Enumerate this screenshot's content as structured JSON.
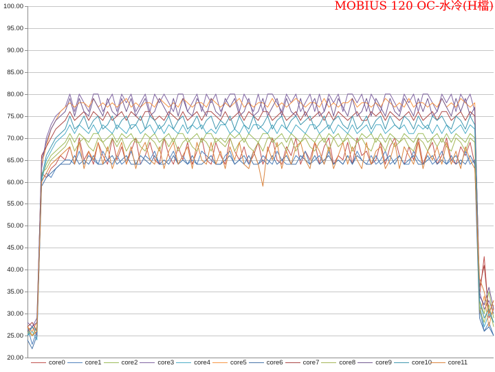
{
  "chart_data": {
    "type": "line",
    "title": "MOBIUS 120 OC-水冷(H檔)",
    "title_color": "#FF0000",
    "xlabel": "",
    "ylabel": "",
    "ylim": [
      20,
      100
    ],
    "y_ticks": [
      "20.00",
      "25.00",
      "30.00",
      "35.00",
      "40.00",
      "45.00",
      "50.00",
      "55.00",
      "60.00",
      "65.00",
      "70.00",
      "75.00",
      "80.00",
      "85.00",
      "90.00",
      "95.00",
      "100.00"
    ],
    "grid": true,
    "legend": "bottom",
    "series": [
      {
        "name": "core0",
        "color": "#C0504D",
        "values": [
          26,
          27,
          25,
          62,
          61,
          63,
          64,
          66,
          65,
          68,
          64,
          70,
          65,
          67,
          64,
          69,
          66,
          64,
          70,
          65,
          68,
          64,
          67,
          70,
          64,
          66,
          69,
          65,
          64,
          70,
          66,
          64,
          68,
          65,
          69,
          64,
          67,
          70,
          65,
          64,
          69,
          66,
          64,
          70,
          67,
          65,
          68,
          64,
          66,
          69,
          64,
          67,
          70,
          65,
          64,
          68,
          66,
          70,
          64,
          67,
          65,
          69,
          64,
          68,
          70,
          64,
          66,
          65,
          69,
          64,
          70,
          66,
          67,
          64,
          65,
          69,
          64,
          68,
          70,
          66,
          64,
          68,
          65,
          70,
          64,
          67,
          69,
          64,
          66,
          70,
          65,
          64,
          68,
          66,
          69,
          64,
          34,
          43,
          29,
          31
        ]
      },
      {
        "name": "core1",
        "color": "#4F81BD",
        "values": [
          27,
          23,
          26,
          60,
          62,
          61,
          63,
          64,
          65,
          65,
          64,
          67,
          64,
          66,
          65,
          64,
          67,
          65,
          64,
          66,
          64,
          65,
          67,
          64,
          64,
          66,
          65,
          67,
          64,
          64,
          65,
          67,
          64,
          66,
          64,
          65,
          64,
          67,
          66,
          65,
          64,
          64,
          66,
          67,
          64,
          65,
          66,
          64,
          67,
          64,
          66,
          65,
          64,
          67,
          65,
          64,
          64,
          66,
          65,
          67,
          64,
          65,
          66,
          64,
          67,
          64,
          65,
          64,
          66,
          64,
          67,
          65,
          64,
          66,
          64,
          65,
          67,
          64,
          65,
          66,
          64,
          64,
          67,
          65,
          64,
          66,
          64,
          65,
          67,
          64,
          65,
          66,
          64,
          67,
          64,
          65,
          31,
          26,
          28,
          25
        ]
      },
      {
        "name": "core2",
        "color": "#9BBB59",
        "values": [
          26,
          25,
          27,
          61,
          64,
          66,
          67,
          68,
          69,
          71,
          69,
          71,
          70,
          69,
          71,
          71,
          69,
          70,
          71,
          69,
          71,
          70,
          71,
          69,
          69,
          71,
          70,
          71,
          69,
          70,
          71,
          69,
          71,
          71,
          69,
          70,
          71,
          69,
          71,
          71,
          69,
          70,
          69,
          71,
          70,
          71,
          69,
          71,
          70,
          69,
          71,
          71,
          69,
          70,
          71,
          69,
          71,
          70,
          69,
          71,
          70,
          69,
          71,
          69,
          71,
          70,
          71,
          69,
          71,
          70,
          69,
          71,
          70,
          71,
          69,
          71,
          69,
          71,
          70,
          69,
          71,
          70,
          69,
          71,
          71,
          69,
          70,
          71,
          69,
          71,
          69,
          71,
          70,
          69,
          71,
          70,
          33,
          30,
          35,
          29
        ]
      },
      {
        "name": "core3",
        "color": "#8064A2",
        "values": [
          28,
          27,
          29,
          63,
          70,
          73,
          75,
          76,
          77,
          80,
          76,
          80,
          78,
          76,
          80,
          80,
          76,
          78,
          80,
          76,
          80,
          78,
          80,
          76,
          78,
          80,
          76,
          80,
          78,
          80,
          78,
          76,
          80,
          80,
          76,
          78,
          80,
          76,
          80,
          78,
          80,
          76,
          78,
          80,
          80,
          76,
          80,
          78,
          76,
          80,
          76,
          80,
          80,
          78,
          76,
          80,
          78,
          80,
          76,
          78,
          80,
          76,
          80,
          76,
          80,
          78,
          80,
          76,
          80,
          80,
          78,
          80,
          76,
          80,
          78,
          76,
          80,
          80,
          78,
          76,
          80,
          78,
          80,
          76,
          80,
          80,
          78,
          76,
          80,
          78,
          80,
          76,
          80,
          78,
          80,
          76,
          35,
          31,
          33,
          30
        ]
      },
      {
        "name": "core4",
        "color": "#4BACC6",
        "values": [
          25,
          26,
          24,
          60,
          65,
          67,
          69,
          70,
          71,
          73,
          71,
          73,
          72,
          71,
          73,
          71,
          73,
          72,
          71,
          73,
          72,
          71,
          73,
          73,
          71,
          72,
          73,
          71,
          73,
          71,
          73,
          72,
          71,
          73,
          71,
          73,
          72,
          73,
          71,
          72,
          71,
          73,
          73,
          71,
          72,
          71,
          73,
          71,
          73,
          73,
          72,
          71,
          73,
          71,
          73,
          72,
          71,
          73,
          72,
          71,
          73,
          73,
          71,
          72,
          73,
          71,
          73,
          72,
          71,
          73,
          71,
          72,
          73,
          71,
          73,
          73,
          71,
          72,
          73,
          72,
          73,
          71,
          71,
          73,
          72,
          73,
          71,
          73,
          71,
          73,
          71,
          72,
          73,
          71,
          73,
          72,
          32,
          27,
          30,
          28
        ]
      },
      {
        "name": "core5",
        "color": "#F79646",
        "values": [
          27,
          26,
          28,
          64,
          68,
          72,
          74,
          76,
          77,
          78,
          77,
          78,
          78,
          77,
          79,
          77,
          78,
          77,
          78,
          77,
          78,
          79,
          77,
          78,
          77,
          78,
          78,
          77,
          79,
          78,
          77,
          78,
          77,
          79,
          78,
          77,
          78,
          78,
          77,
          79,
          78,
          77,
          78,
          77,
          78,
          79,
          77,
          78,
          77,
          78,
          78,
          77,
          79,
          77,
          78,
          77,
          78,
          79,
          78,
          77,
          78,
          78,
          77,
          79,
          77,
          78,
          77,
          78,
          78,
          79,
          77,
          78,
          78,
          77,
          78,
          77,
          79,
          78,
          77,
          78,
          77,
          79,
          77,
          78,
          78,
          77,
          78,
          77,
          79,
          77,
          78,
          77,
          79,
          78,
          77,
          78,
          30,
          34,
          27,
          32
        ]
      },
      {
        "name": "core6",
        "color": "#4572A7",
        "values": [
          24,
          22,
          25,
          59,
          61,
          62,
          63,
          64,
          64,
          64,
          66,
          64,
          65,
          64,
          66,
          64,
          64,
          65,
          66,
          64,
          65,
          66,
          64,
          64,
          66,
          65,
          64,
          66,
          64,
          65,
          64,
          66,
          64,
          65,
          64,
          66,
          64,
          64,
          65,
          66,
          64,
          64,
          65,
          66,
          64,
          65,
          64,
          66,
          64,
          64,
          65,
          64,
          66,
          64,
          65,
          66,
          64,
          64,
          66,
          65,
          64,
          66,
          64,
          65,
          66,
          64,
          65,
          64,
          66,
          64,
          66,
          65,
          64,
          64,
          66,
          64,
          65,
          66,
          64,
          66,
          64,
          65,
          66,
          64,
          64,
          65,
          66,
          64,
          65,
          64,
          66,
          64,
          65,
          64,
          66,
          64,
          29,
          26,
          27,
          25
        ]
      },
      {
        "name": "core7",
        "color": "#AA4643",
        "values": [
          27,
          28,
          26,
          66,
          68,
          70,
          72,
          73,
          74,
          76,
          74,
          75,
          76,
          74,
          76,
          75,
          74,
          76,
          74,
          75,
          76,
          74,
          76,
          75,
          74,
          76,
          76,
          74,
          75,
          74,
          76,
          75,
          74,
          76,
          74,
          75,
          76,
          74,
          76,
          76,
          75,
          74,
          76,
          74,
          75,
          76,
          74,
          76,
          75,
          74,
          76,
          76,
          74,
          75,
          76,
          74,
          75,
          76,
          74,
          76,
          74,
          75,
          76,
          74,
          76,
          74,
          76,
          75,
          74,
          75,
          76,
          74,
          74,
          76,
          75,
          76,
          74,
          76,
          75,
          74,
          75,
          76,
          74,
          76,
          74,
          75,
          76,
          74,
          76,
          76,
          74,
          75,
          76,
          74,
          76,
          75,
          36,
          41,
          30,
          33
        ]
      },
      {
        "name": "core8",
        "color": "#A5B557",
        "values": [
          26,
          25,
          26,
          62,
          63,
          65,
          66,
          67,
          68,
          70,
          67,
          69,
          70,
          68,
          67,
          70,
          69,
          67,
          70,
          68,
          70,
          67,
          69,
          70,
          68,
          67,
          70,
          69,
          67,
          70,
          68,
          70,
          67,
          69,
          70,
          68,
          67,
          70,
          69,
          67,
          70,
          69,
          68,
          70,
          67,
          69,
          70,
          68,
          67,
          69,
          67,
          70,
          70,
          68,
          69,
          67,
          70,
          67,
          69,
          70,
          68,
          67,
          69,
          70,
          67,
          70,
          68,
          69,
          70,
          67,
          69,
          70,
          68,
          67,
          70,
          69,
          67,
          70,
          68,
          69,
          70,
          68,
          67,
          70,
          69,
          67,
          70,
          68,
          70,
          68,
          67,
          70,
          69,
          67,
          70,
          69,
          31,
          28,
          32,
          27
        ]
      },
      {
        "name": "core9",
        "color": "#71588F",
        "values": [
          26,
          27,
          28,
          65,
          69,
          72,
          74,
          75,
          76,
          79,
          75,
          79,
          76,
          75,
          79,
          77,
          75,
          79,
          76,
          75,
          79,
          76,
          79,
          75,
          77,
          79,
          75,
          76,
          79,
          77,
          75,
          79,
          75,
          79,
          76,
          75,
          79,
          77,
          75,
          79,
          76,
          75,
          79,
          77,
          79,
          75,
          76,
          79,
          75,
          76,
          79,
          75,
          77,
          79,
          75,
          79,
          76,
          75,
          79,
          75,
          77,
          79,
          75,
          76,
          79,
          75,
          79,
          77,
          75,
          79,
          75,
          76,
          79,
          75,
          79,
          77,
          75,
          79,
          76,
          75,
          79,
          77,
          75,
          79,
          76,
          79,
          75,
          76,
          79,
          77,
          75,
          79,
          76,
          79,
          75,
          77,
          34,
          32,
          36,
          31
        ]
      },
      {
        "name": "core10",
        "color": "#3D96AE",
        "values": [
          25,
          27,
          26,
          61,
          66,
          68,
          70,
          71,
          72,
          75,
          72,
          73,
          75,
          72,
          74,
          75,
          72,
          73,
          75,
          72,
          74,
          75,
          72,
          73,
          75,
          72,
          75,
          74,
          72,
          73,
          75,
          72,
          74,
          75,
          72,
          73,
          75,
          72,
          74,
          75,
          72,
          74,
          73,
          75,
          72,
          75,
          73,
          72,
          75,
          72,
          73,
          75,
          72,
          74,
          75,
          72,
          74,
          75,
          73,
          74,
          75,
          72,
          73,
          75,
          72,
          74,
          75,
          73,
          72,
          75,
          72,
          73,
          75,
          72,
          74,
          75,
          72,
          75,
          73,
          72,
          75,
          74,
          72,
          75,
          73,
          72,
          75,
          74,
          75,
          73,
          72,
          75,
          74,
          72,
          75,
          73,
          33,
          29,
          31,
          28
        ]
      },
      {
        "name": "core11",
        "color": "#DB843D",
        "values": [
          27,
          25,
          26,
          60,
          62,
          64,
          65,
          66,
          67,
          68,
          64,
          69,
          63,
          67,
          65,
          69,
          64,
          68,
          63,
          66,
          69,
          64,
          68,
          63,
          67,
          69,
          65,
          64,
          68,
          63,
          67,
          69,
          64,
          66,
          68,
          63,
          69,
          65,
          64,
          69,
          64,
          67,
          63,
          68,
          65,
          69,
          64,
          63,
          67,
          64,
          59,
          68,
          65,
          69,
          63,
          67,
          64,
          68,
          69,
          65,
          63,
          69,
          67,
          64,
          68,
          63,
          66,
          69,
          64,
          68,
          65,
          63,
          69,
          64,
          67,
          68,
          63,
          65,
          69,
          63,
          68,
          66,
          64,
          69,
          63,
          67,
          65,
          68,
          64,
          69,
          64,
          67,
          63,
          68,
          65,
          63,
          38,
          35,
          30,
          33
        ]
      }
    ]
  }
}
